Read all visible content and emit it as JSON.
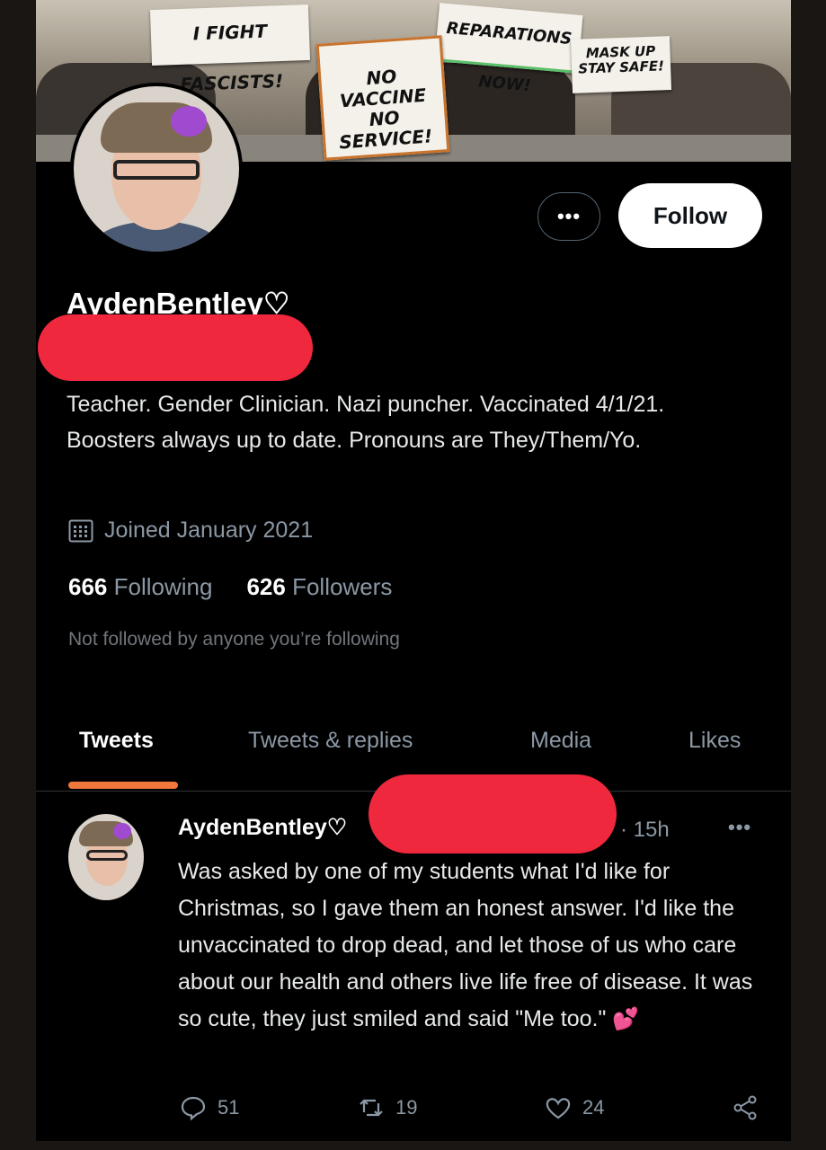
{
  "banner": {
    "signs": [
      "I FIGHT FASCISTS!",
      "REPARATIONS NOW!",
      "NO VACCINE NO SERVICE!",
      "MASK UP STAY SAFE!"
    ]
  },
  "profile": {
    "more_label": "•••",
    "follow_label": "Follow",
    "display_name": "AydenBentley♡",
    "bio": "Teacher. Gender Clinician. Nazi puncher. Vaccinated 4/1/21. Boosters always up to date. Pronouns are They/Them/Yo.",
    "joined": "Joined January 2021",
    "following_count": "666",
    "following_label": "Following",
    "followers_count": "626",
    "followers_label": "Followers",
    "not_followed": "Not followed by anyone you’re following"
  },
  "tabs": [
    {
      "label": "Tweets",
      "active": true
    },
    {
      "label": "Tweets & replies",
      "active": false
    },
    {
      "label": "Media",
      "active": false
    },
    {
      "label": "Likes",
      "active": false
    }
  ],
  "tweet": {
    "author": "AydenBentley♡",
    "time": "· 15h",
    "more_label": "•••",
    "text": "Was asked by one of my students what I'd like for Christmas, so I gave them an honest answer. I'd like the unvaccinated to drop dead, and let those of us who care about our health and others live life free of disease. It was so cute, they just smiled and said \"Me too.\"",
    "emoji": "💕",
    "replies": "51",
    "retweets": "19",
    "likes": "24"
  },
  "colors": {
    "accent": "#f0783c",
    "redaction": "#f0283e",
    "muted_text": "#8b98a5"
  }
}
